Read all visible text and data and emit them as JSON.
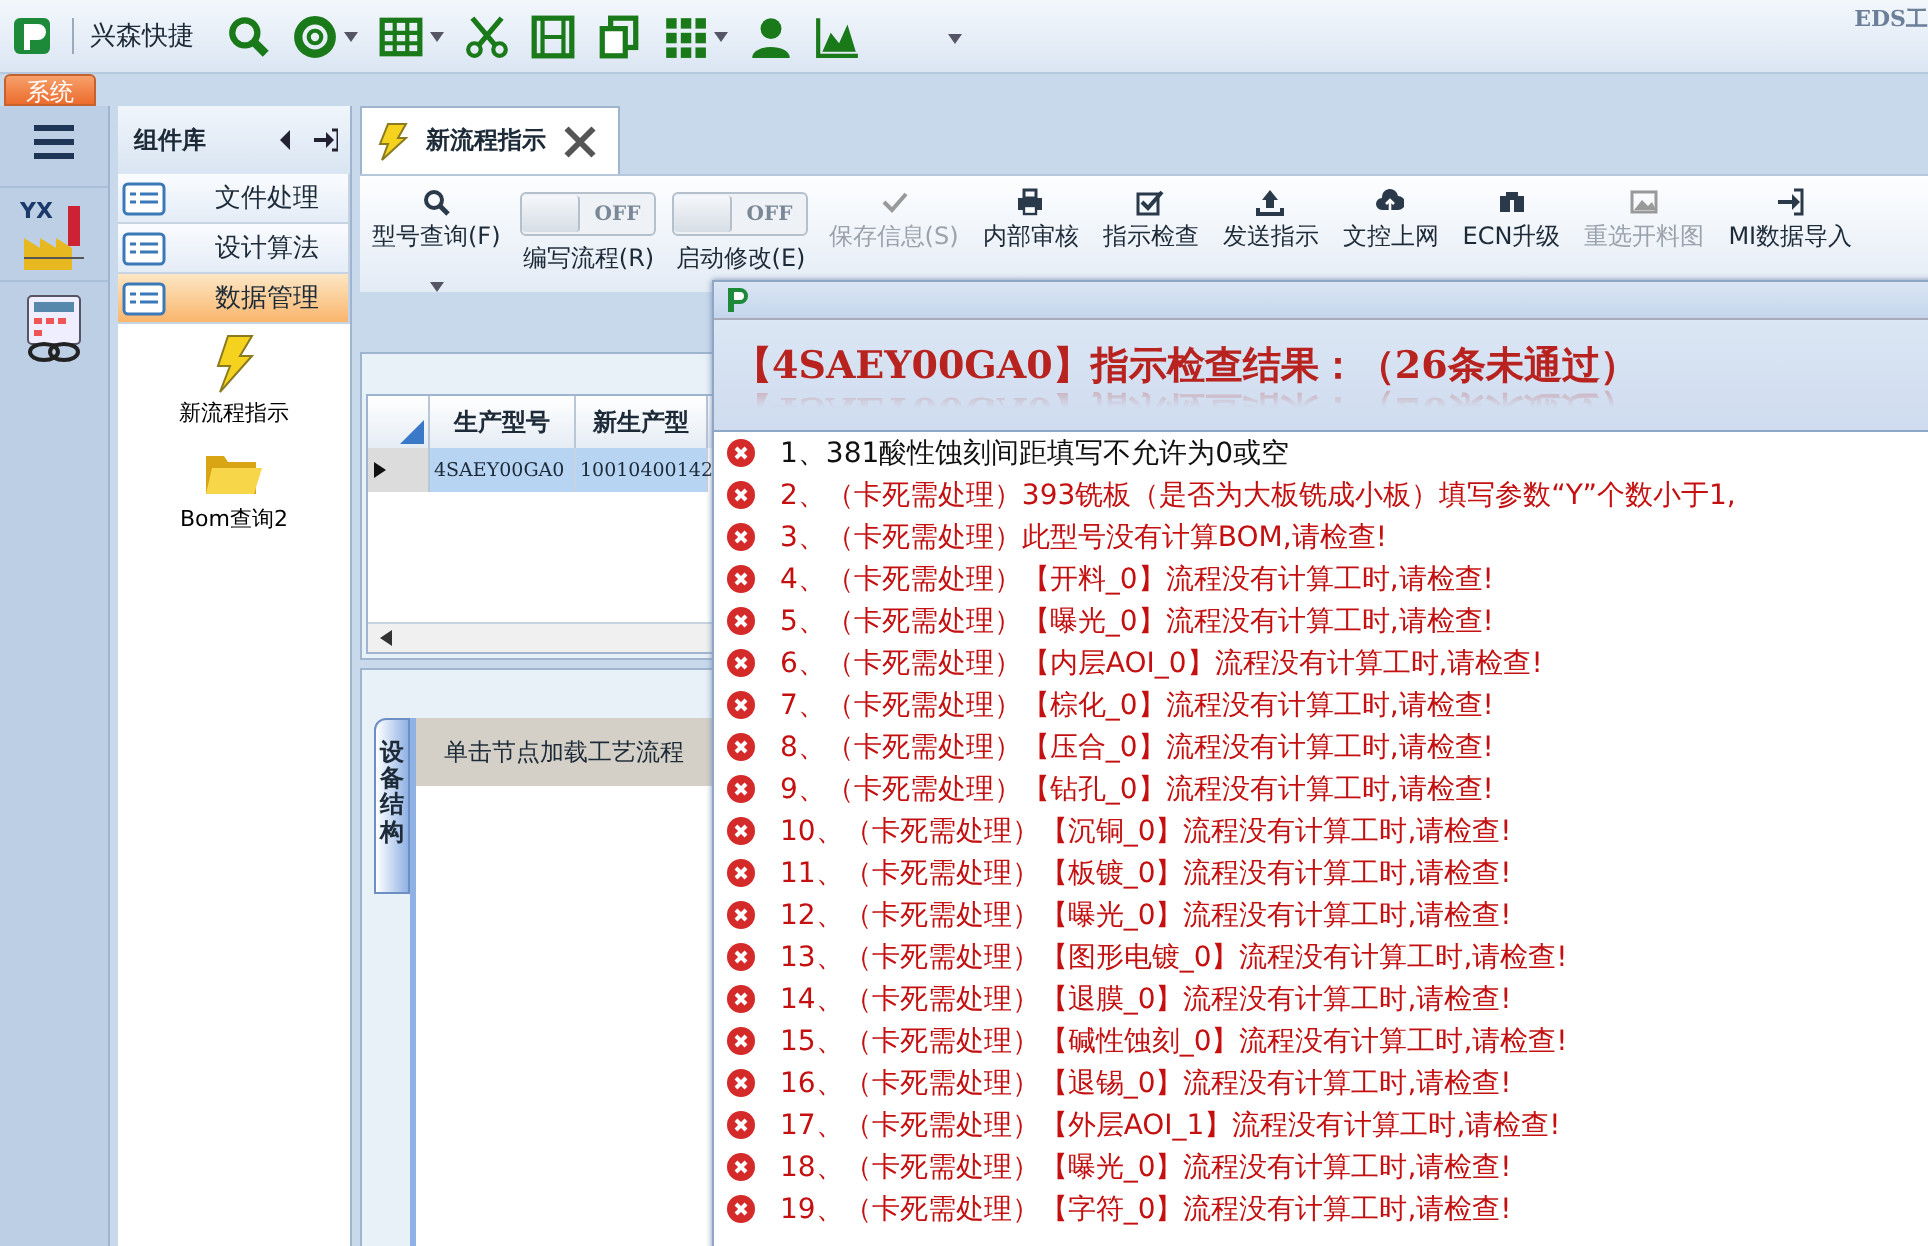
{
  "app": {
    "quick_toolbar_title": "兴森快捷",
    "corner_text": "EDS工",
    "quick_tools": [
      {
        "dropdown": false
      },
      {
        "dropdown": true
      },
      {
        "dropdown": true
      },
      {
        "dropdown": false
      },
      {
        "dropdown": false
      },
      {
        "dropdown": false
      },
      {
        "dropdown": true
      },
      {
        "dropdown": false
      },
      {
        "dropdown": false
      }
    ],
    "ribbon_tabs": [
      {
        "label": "系统",
        "selected": true
      }
    ]
  },
  "side_apps": [
    {
      "kind": "factory",
      "label": "YX"
    },
    {
      "kind": "calculator"
    }
  ],
  "component_library": {
    "title": "组件库",
    "groups": [
      {
        "label": "文件处理",
        "selected": false
      },
      {
        "label": "设计算法",
        "selected": false
      },
      {
        "label": "数据管理",
        "selected": true
      }
    ],
    "items": [
      {
        "kind": "bolt",
        "label": "新流程指示"
      },
      {
        "kind": "folder",
        "label": "Bom查询2"
      }
    ]
  },
  "document_tabs": [
    {
      "label": "新流程指示",
      "selected": true
    }
  ],
  "toolbar": [
    {
      "kind": "dropdown",
      "label": "型号查询(F)",
      "disabled": false
    },
    {
      "kind": "toggle",
      "label": "编写流程(R)",
      "state_text": "OFF",
      "on": false
    },
    {
      "kind": "toggle",
      "label": "启动修改(E)",
      "state_text": "OFF",
      "on": false
    },
    {
      "kind": "button",
      "label": "保存信息(S)",
      "disabled": true
    },
    {
      "kind": "button",
      "label": "内部审核",
      "disabled": false
    },
    {
      "kind": "button",
      "label": "指示检查",
      "disabled": false
    },
    {
      "kind": "button",
      "label": "发送指示",
      "disabled": false
    },
    {
      "kind": "button",
      "label": "文控上网",
      "disabled": false
    },
    {
      "kind": "button",
      "label": "ECN升级",
      "disabled": false
    },
    {
      "kind": "button",
      "label": "重选开料图",
      "disabled": true
    },
    {
      "kind": "button",
      "label": "MI数据导入",
      "disabled": false
    }
  ],
  "table": {
    "columns": [
      "生产型号",
      "新生产型"
    ],
    "rows": [
      {
        "cells": [
          "4SAEY00GA0",
          "10010400142"
        ],
        "selected": true
      }
    ]
  },
  "lower_panel": {
    "side_tab": "设备结构",
    "header": "单击节点加载工艺流程"
  },
  "dialog": {
    "title": "【4SAEY00GA0】指示检查结果：（26条未通过）",
    "results": [
      {
        "kind": "notice",
        "text": "1、381酸性蚀刻间距填写不允许为0或空"
      },
      {
        "kind": "blocking",
        "text": "2、（卡死需处理）393铣板（是否为大板铣成小板）填写参数“Y”个数小于1,"
      },
      {
        "kind": "blocking",
        "text": "3、（卡死需处理）此型号没有计算BOM,请检查!"
      },
      {
        "kind": "blocking",
        "text": "4、（卡死需处理）【开料_0】流程没有计算工时,请检查!"
      },
      {
        "kind": "blocking",
        "text": "5、（卡死需处理）【曝光_0】流程没有计算工时,请检查!"
      },
      {
        "kind": "blocking",
        "text": "6、（卡死需处理）【内层AOI_0】流程没有计算工时,请检查!"
      },
      {
        "kind": "blocking",
        "text": "7、（卡死需处理）【棕化_0】流程没有计算工时,请检查!"
      },
      {
        "kind": "blocking",
        "text": "8、（卡死需处理）【压合_0】流程没有计算工时,请检查!"
      },
      {
        "kind": "blocking",
        "text": "9、（卡死需处理）【钻孔_0】流程没有计算工时,请检查!"
      },
      {
        "kind": "blocking",
        "text": "10、（卡死需处理）【沉铜_0】流程没有计算工时,请检查!"
      },
      {
        "kind": "blocking",
        "text": "11、（卡死需处理）【板镀_0】流程没有计算工时,请检查!"
      },
      {
        "kind": "blocking",
        "text": "12、（卡死需处理）【曝光_0】流程没有计算工时,请检查!"
      },
      {
        "kind": "blocking",
        "text": "13、（卡死需处理）【图形电镀_0】流程没有计算工时,请检查!"
      },
      {
        "kind": "blocking",
        "text": "14、（卡死需处理）【退膜_0】流程没有计算工时,请检查!"
      },
      {
        "kind": "blocking",
        "text": "15、（卡死需处理）【碱性蚀刻_0】流程没有计算工时,请检查!"
      },
      {
        "kind": "blocking",
        "text": "16、（卡死需处理）【退锡_0】流程没有计算工时,请检查!"
      },
      {
        "kind": "blocking",
        "text": "17、（卡死需处理）【外层AOI_1】流程没有计算工时,请检查!"
      },
      {
        "kind": "blocking",
        "text": "18、（卡死需处理）【曝光_0】流程没有计算工时,请检查!"
      },
      {
        "kind": "blocking",
        "text": "19、（卡死需处理）【字符_0】流程没有计算工时,请检查!"
      }
    ]
  }
}
